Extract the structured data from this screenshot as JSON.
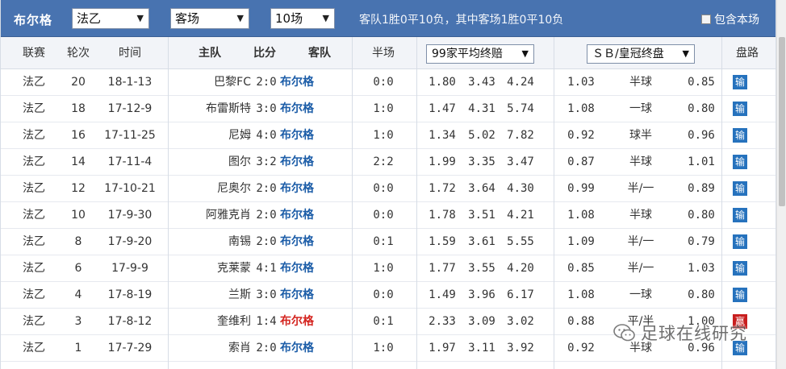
{
  "topbar": {
    "team": "布尔格",
    "league_select": "法乙",
    "venue_select": "客场",
    "count_select": "10场",
    "summary": "客队1胜0平10负，其中客场1胜0平10负",
    "home_only_label": "包含本场",
    "select_arrow": "▼"
  },
  "header": {
    "league": "联赛",
    "round": "轮次",
    "time": "时间",
    "home": "主队",
    "score": "比分",
    "away": "客队",
    "halftime": "半场",
    "odds_select": "99家平均终赔",
    "handicap_select": "ＳＢ/皇冠终盘",
    "result": "盘路"
  },
  "rows": [
    {
      "league": "法乙",
      "round": "20",
      "time": "18-1-13",
      "home": "巴黎FC",
      "score": "2:0",
      "away": "布尔格",
      "half": "0:0",
      "o1": "1.80",
      "o2": "3.43",
      "o3": "4.24",
      "h1": "1.03",
      "hl": "半球",
      "h2": "0.85",
      "res": "输",
      "res_type": "lose",
      "away_color": "#1c5da8"
    },
    {
      "league": "法乙",
      "round": "18",
      "time": "17-12-9",
      "home": "布雷斯特",
      "score": "3:0",
      "away": "布尔格",
      "half": "1:0",
      "o1": "1.47",
      "o2": "4.31",
      "o3": "5.74",
      "h1": "1.08",
      "hl": "一球",
      "h2": "0.80",
      "res": "输",
      "res_type": "lose",
      "away_color": "#1c5da8"
    },
    {
      "league": "法乙",
      "round": "16",
      "time": "17-11-25",
      "home": "尼姆",
      "score": "4:0",
      "away": "布尔格",
      "half": "1:0",
      "o1": "1.34",
      "o2": "5.02",
      "o3": "7.82",
      "h1": "0.92",
      "hl": "球半",
      "h2": "0.96",
      "res": "输",
      "res_type": "lose",
      "away_color": "#1c5da8"
    },
    {
      "league": "法乙",
      "round": "14",
      "time": "17-11-4",
      "home": "图尔",
      "score": "3:2",
      "away": "布尔格",
      "half": "2:2",
      "o1": "1.99",
      "o2": "3.35",
      "o3": "3.47",
      "h1": "0.87",
      "hl": "半球",
      "h2": "1.01",
      "res": "输",
      "res_type": "lose",
      "away_color": "#1c5da8"
    },
    {
      "league": "法乙",
      "round": "12",
      "time": "17-10-21",
      "home": "尼奥尔",
      "score": "2:0",
      "away": "布尔格",
      "half": "0:0",
      "o1": "1.72",
      "o2": "3.64",
      "o3": "4.30",
      "h1": "0.99",
      "hl": "半/一",
      "h2": "0.89",
      "res": "输",
      "res_type": "lose",
      "away_color": "#1c5da8"
    },
    {
      "league": "法乙",
      "round": "10",
      "time": "17-9-30",
      "home": "阿雅克肖",
      "score": "2:0",
      "away": "布尔格",
      "half": "0:0",
      "o1": "1.78",
      "o2": "3.51",
      "o3": "4.21",
      "h1": "1.08",
      "hl": "半球",
      "h2": "0.80",
      "res": "输",
      "res_type": "lose",
      "away_color": "#1c5da8"
    },
    {
      "league": "法乙",
      "round": "8",
      "time": "17-9-20",
      "home": "南锡",
      "score": "2:0",
      "away": "布尔格",
      "half": "0:1",
      "o1": "1.59",
      "o2": "3.61",
      "o3": "5.55",
      "h1": "1.09",
      "hl": "半/一",
      "h2": "0.79",
      "res": "输",
      "res_type": "lose",
      "away_color": "#1c5da8"
    },
    {
      "league": "法乙",
      "round": "6",
      "time": "17-9-9",
      "home": "克莱蒙",
      "score": "4:1",
      "away": "布尔格",
      "half": "1:0",
      "o1": "1.77",
      "o2": "3.55",
      "o3": "4.20",
      "h1": "0.85",
      "hl": "半/一",
      "h2": "1.03",
      "res": "输",
      "res_type": "lose",
      "away_color": "#1c5da8"
    },
    {
      "league": "法乙",
      "round": "4",
      "time": "17-8-19",
      "home": "兰斯",
      "score": "3:0",
      "away": "布尔格",
      "half": "0:0",
      "o1": "1.49",
      "o2": "3.96",
      "o3": "6.17",
      "h1": "1.08",
      "hl": "一球",
      "h2": "0.80",
      "res": "输",
      "res_type": "lose",
      "away_color": "#1c5da8"
    },
    {
      "league": "法乙",
      "round": "3",
      "time": "17-8-12",
      "home": "奎维利",
      "score": "1:4",
      "away": "布尔格",
      "half": "0:1",
      "o1": "2.33",
      "o3": "3.02",
      "o2": "3.09",
      "h1": "0.88",
      "hl": "平/半",
      "h2": "1.00",
      "res": "赢",
      "res_type": "win",
      "away_color": "#d4241f"
    },
    {
      "league": "法乙",
      "round": "1",
      "time": "17-7-29",
      "home": "索肖",
      "score": "2:0",
      "away": "布尔格",
      "half": "1:0",
      "o1": "1.97",
      "o2": "3.11",
      "o3": "3.92",
      "h1": "0.92",
      "hl": "半球",
      "h2": "0.96",
      "res": "输",
      "res_type": "lose",
      "away_color": "#1c5da8"
    }
  ],
  "watermark": {
    "text": "足球在线研究"
  },
  "colors": {
    "topbar_bg": "#4873b0",
    "away_blue": "#1c5da8",
    "away_red": "#d4241f",
    "badge_lose": "#2672bd",
    "badge_win": "#c81e1e"
  }
}
